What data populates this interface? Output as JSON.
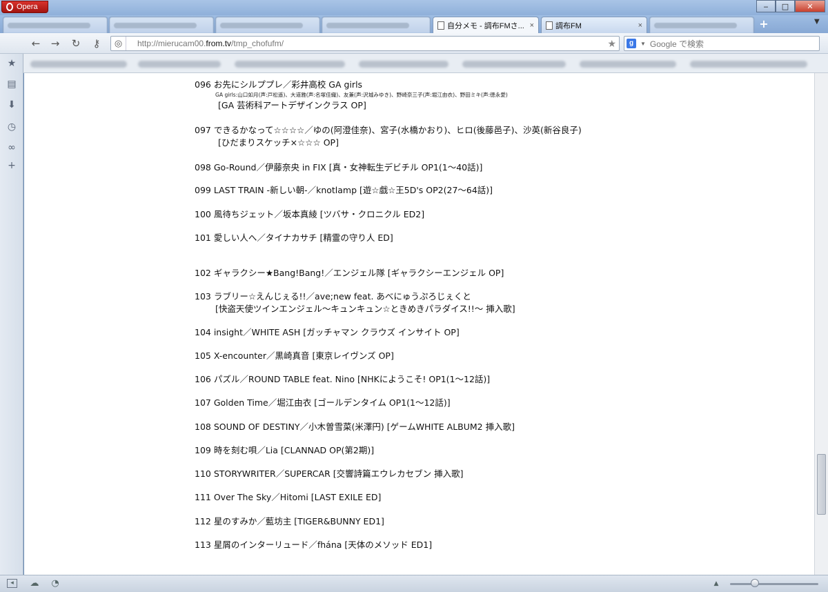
{
  "app": {
    "name": "Opera"
  },
  "window_controls": {
    "minimize": "‒",
    "maximize": "□",
    "close": "✕"
  },
  "tabs": [
    {
      "label": "自分メモ - 調布FMさ...",
      "close": "×"
    },
    {
      "label": "調布FM",
      "close": "×"
    }
  ],
  "tab_add": "+",
  "address": {
    "prefix": "http://mierucam00.",
    "domain": "from.tv",
    "suffix": "/tmp_chofufm/"
  },
  "search": {
    "placeholder": "Google で検索"
  },
  "entries": [
    {
      "main": "096 お先にシルププレ／彩井高校 GA girls",
      "tiny": "GA girls:山口如月(声:戸松遥)、大道雅(声:名塚佳織)、友兼(声:沢城みゆき)、野崎奈三子(声:堀江由衣)、野田ミキ(声:徳永愛)",
      "sub": "[GA 芸術科アートデザインクラス OP]"
    },
    {
      "main": "097 できるかなって☆☆☆☆／ゆの(阿澄佳奈)、宮子(水橋かおり)、ヒロ(後藤邑子)、沙英(新谷良子)",
      "sub": "[ひだまりスケッチ×☆☆☆ OP]"
    },
    {
      "main": "098 Go-Round／伊藤奈央 in FIX [真・女神転生デビチル OP1(1〜40話)]"
    },
    {
      "main": "099 LAST TRAIN -新しい朝-／knotlamp [遊☆戯☆王5D's OP2(27〜64話)]"
    },
    {
      "main": "100 風待ちジェット／坂本真綾 [ツバサ・クロニクル ED2]"
    },
    {
      "main": "101 愛しい人へ／タイナカサチ [精霊の守り人 ED]"
    },
    {
      "main": "102 ギャラクシー★Bang!Bang!／エンジェル隊 [ギャラクシーエンジェル OP]"
    },
    {
      "main": "103 ラブリー☆えんじぇる!!／ave;new feat. あべにゅうぷろじぇくと",
      "sub": "[快盗天使ツインエンジェル〜キュンキュン☆ときめきパラダイス!!〜 挿入歌]"
    },
    {
      "main": "104 insight／WHITE ASH [ガッチャマン クラウズ インサイト OP]"
    },
    {
      "main": "105 X-encounter／黒崎真音 [東京レイヴンズ OP]"
    },
    {
      "main": "106 パズル／ROUND TABLE feat. Nino [NHKにようこそ! OP1(1〜12話)]"
    },
    {
      "main": "107 Golden Time／堀江由衣 [ゴールデンタイム OP1(1〜12話)]"
    },
    {
      "main": "108 SOUND OF DESTINY／小木曽雪菜(米澤円) [ゲームWHITE ALBUM2 挿入歌]"
    },
    {
      "main": "109 時を刻む唄／Lia [CLANNAD OP(第2期)]"
    },
    {
      "main": "110 STORYWRITER／SUPERCAR [交響詩篇エウレカセブン 挿入歌]"
    },
    {
      "main": "111 Over The Sky／Hitomi [LAST EXILE ED]"
    },
    {
      "main": "112 星のすみか／藍坊主 [TIGER&BUNNY ED1]"
    },
    {
      "main": "113 星屑のインターリュード／fhána [天体のメソッド ED1]"
    }
  ]
}
